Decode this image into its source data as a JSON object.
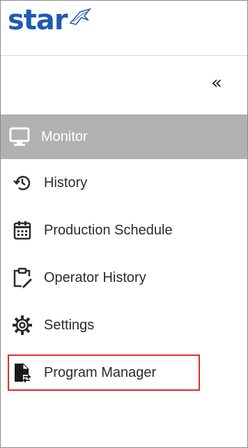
{
  "header": {
    "logo_text": "star",
    "collapse_label": "«"
  },
  "nav": {
    "items": [
      {
        "label": "Monitor",
        "icon": "monitor-icon",
        "active": true
      },
      {
        "label": "History",
        "icon": "history-icon"
      },
      {
        "label": "Production Schedule",
        "icon": "calendar-icon"
      },
      {
        "label": "Operator History",
        "icon": "clipboard-edit-icon"
      },
      {
        "label": "Settings",
        "icon": "gear-icon"
      },
      {
        "label": "Program Manager",
        "icon": "file-transfer-icon",
        "highlighted": true
      }
    ]
  },
  "colors": {
    "brand": "#1e5bb3",
    "active_bg": "#b1b1b1",
    "highlight": "#e22b2b",
    "text": "#2b2b2b"
  }
}
